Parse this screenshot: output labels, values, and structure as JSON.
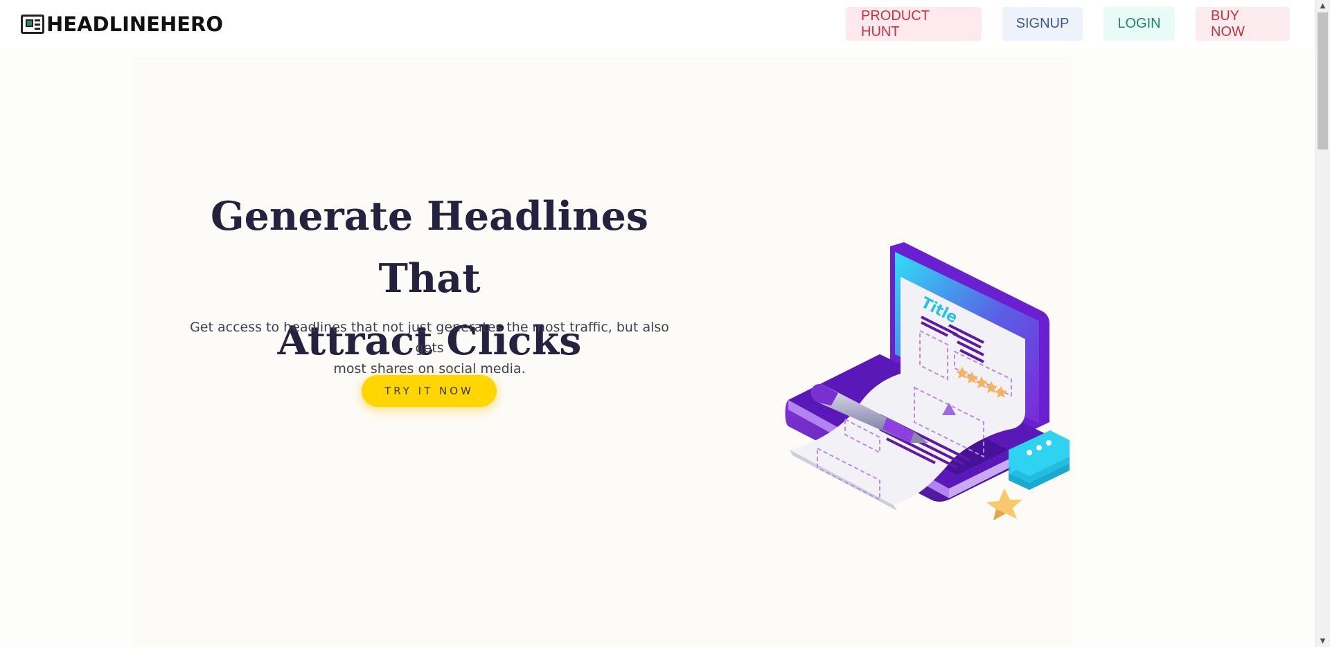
{
  "header": {
    "logo_text": "HEADLINEHERO",
    "nav": {
      "product_hunt": "PRODUCT HUNT",
      "signup": "SIGNUP",
      "login": "LOGIN",
      "buy_now": "BUY NOW"
    }
  },
  "hero": {
    "title_line1": "Generate Headlines That",
    "title_line2": "Attract Clicks",
    "subtitle_line1": "Get access to headlines that not just generates the most traffic, but also gets",
    "subtitle_line2": "most shares on social media.",
    "cta_label": "TRY IT NOW"
  },
  "illustration": {
    "doc_title": "Title",
    "icons": [
      "laptop-icon",
      "document-icon",
      "pen-icon",
      "chat-bubble-icon",
      "star-icon"
    ]
  },
  "colors": {
    "cta": "#ffd600",
    "title": "#24223f",
    "laptop": "#6a1fd1",
    "screen": "#2fd8f0",
    "chat": "#26c6ea"
  }
}
